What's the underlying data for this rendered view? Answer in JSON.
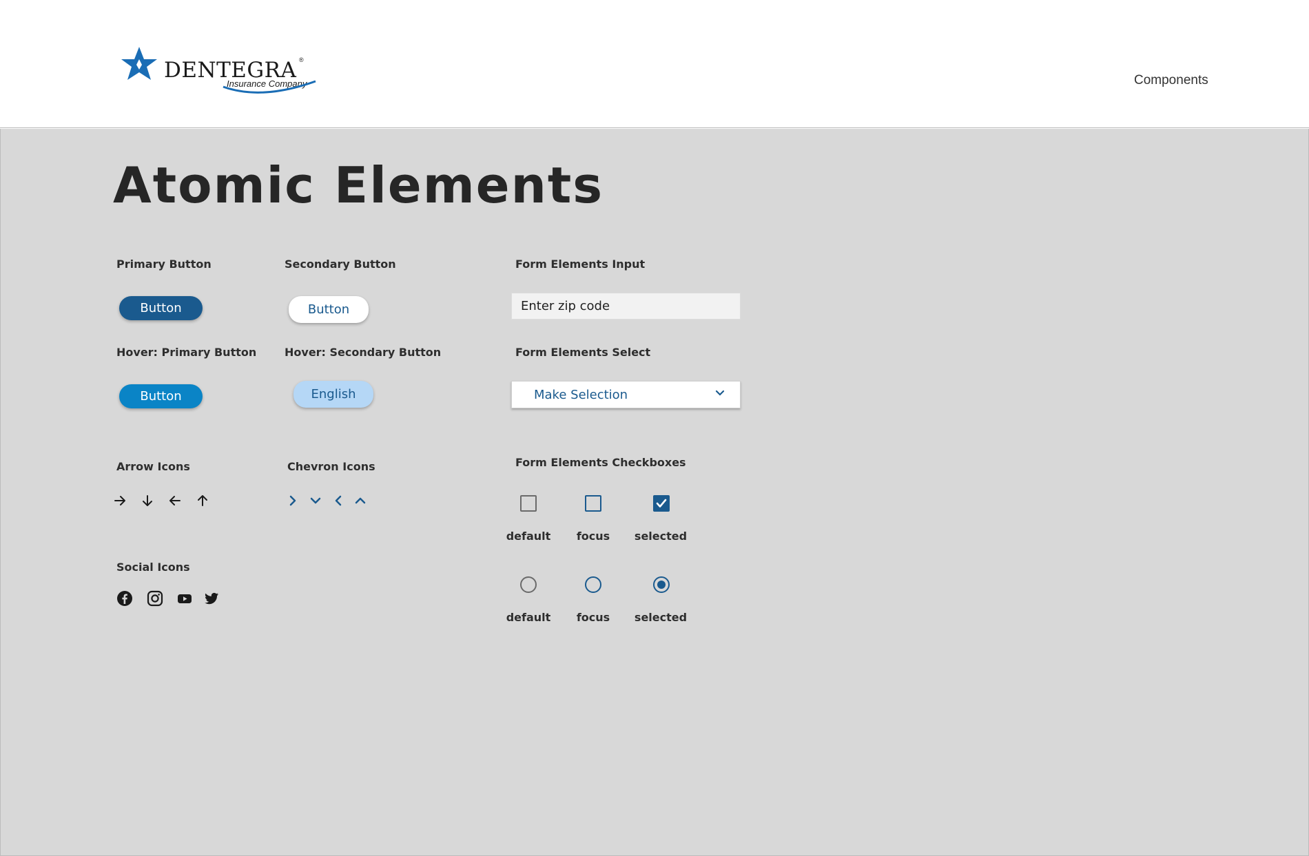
{
  "header": {
    "logo": {
      "brand": "DENTEGRA",
      "registered": "®",
      "subtitle": "Insurance Company"
    },
    "nav_link": "Components"
  },
  "page_title": "Atomic Elements",
  "buttons": {
    "primary_label": "Primary Button",
    "primary_text": "Button",
    "secondary_label": "Secondary Button",
    "secondary_text": "Button",
    "hover_primary_label": "Hover: Primary Button",
    "hover_primary_text": "Button",
    "hover_secondary_label": "Hover: Secondary Button",
    "hover_secondary_text": "English"
  },
  "form": {
    "input_label": "Form Elements Input",
    "input_value": "Enter zip code",
    "select_label": "Form Elements Select",
    "select_value": "Make Selection",
    "checkboxes_label": "Form Elements Checkboxes",
    "checkbox_states": [
      "default",
      "focus",
      "selected"
    ],
    "radio_states": [
      "default",
      "focus",
      "selected"
    ]
  },
  "arrow_icons": {
    "label": "Arrow Icons",
    "icons": [
      "arrow-right-icon",
      "arrow-down-icon",
      "arrow-left-icon",
      "arrow-up-icon"
    ]
  },
  "chevron_icons": {
    "label": "Chevron Icons",
    "icons": [
      "chevron-right-icon",
      "chevron-down-icon",
      "chevron-left-icon",
      "chevron-up-icon"
    ]
  },
  "social_icons": {
    "label": "Social Icons",
    "icons": [
      "facebook-icon",
      "instagram-icon",
      "youtube-icon",
      "twitter-icon"
    ]
  },
  "colors": {
    "brand_blue": "#1a5a8e",
    "hover_blue": "#0a84c6",
    "hover_secondary": "#b5d7f6",
    "page_gray": "#d8d8d8"
  }
}
